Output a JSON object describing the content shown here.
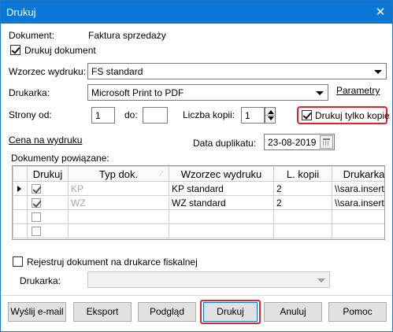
{
  "window": {
    "title": "Drukuj",
    "close_glyph": "✕"
  },
  "document": {
    "label": "Dokument:",
    "value": "Faktura sprzedaży"
  },
  "print_document": {
    "label": "Drukuj dokument",
    "checked": true
  },
  "template": {
    "label": "Wzorzec wydruku:",
    "value": "FS standard"
  },
  "printer": {
    "label": "Drukarka:",
    "value": "Microsoft Print to PDF",
    "params_link": "Parametry"
  },
  "pages": {
    "from_label": "Strony od:",
    "from_value": "1",
    "to_label": "do:",
    "to_value": ""
  },
  "copies": {
    "label": "Liczba kopii:",
    "value": "1"
  },
  "print_only_copy": {
    "label": "Drukuj tylko kopie",
    "checked": true
  },
  "price_link": "Cena na wydruku",
  "duplicate_date": {
    "label": "Data duplikatu:",
    "value": "23-08-2019"
  },
  "related": {
    "label": "Dokumenty powiązane:",
    "columns": [
      "Drukuj",
      "Typ dok.",
      "Wzorzec wydruku",
      "L. kopii",
      "Drukarka"
    ],
    "rows": [
      {
        "print": true,
        "type": "KP",
        "template": "KP standard",
        "copies": "2",
        "printer": "\\\\sara.insert"
      },
      {
        "print": true,
        "type": "WZ",
        "template": "WZ standard",
        "copies": "2",
        "printer": "\\\\sara.insert"
      },
      {
        "print": false,
        "type": "",
        "template": "",
        "copies": "",
        "printer": ""
      },
      {
        "print": false,
        "type": "",
        "template": "",
        "copies": "",
        "printer": ""
      }
    ]
  },
  "fiscal": {
    "label": "Rejestruj dokument na drukarce fiskalnej",
    "checked": false,
    "printer_label": "Drukarka:",
    "printer_value": ""
  },
  "buttons": {
    "email": "Wyślij e-mail",
    "export": "Eksport",
    "preview": "Podgląd",
    "print": "Drukuj",
    "cancel": "Anuluj",
    "help": "Pomoc"
  },
  "colors": {
    "titlebar": "#0b78d7",
    "highlight": "#e0232a"
  }
}
